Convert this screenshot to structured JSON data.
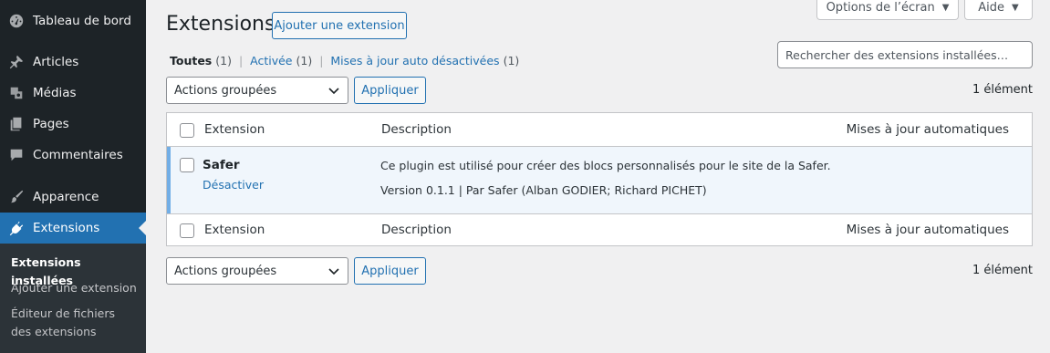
{
  "sidebar": {
    "items": [
      {
        "label": "Tableau de bord",
        "icon": "dashboard-icon"
      },
      {
        "label": "Articles",
        "icon": "pushpin-icon"
      },
      {
        "label": "Médias",
        "icon": "media-icon"
      },
      {
        "label": "Pages",
        "icon": "pages-icon"
      },
      {
        "label": "Commentaires",
        "icon": "comment-icon"
      },
      {
        "label": "Apparence",
        "icon": "paintbrush-icon"
      },
      {
        "label": "Extensions",
        "icon": "plugin-icon",
        "active": true
      }
    ],
    "submenu": [
      {
        "label": "Extensions installées",
        "current": true
      },
      {
        "label": "Ajouter une extension"
      },
      {
        "label": "Éditeur de fichiers des extensions"
      }
    ]
  },
  "screen_options": "Options de l’écran",
  "help": "Aide",
  "page": {
    "title": "Extensions",
    "add_button": "Ajouter une extension"
  },
  "filters": {
    "all_label": "Toutes",
    "all_count": "(1)",
    "active_label": "Activée",
    "active_count": "(1)",
    "auto_label": "Mises à jour auto désactivées",
    "auto_count": "(1)"
  },
  "search": {
    "placeholder": "Rechercher des extensions installées…"
  },
  "bulk": {
    "select_label": "Actions groupées",
    "apply_label": "Appliquer",
    "count": "1 élément"
  },
  "table": {
    "columns": [
      "Extension",
      "Description",
      "Mises à jour automatiques"
    ],
    "rows": [
      {
        "name": "Safer",
        "action": "Désactiver",
        "description": "Ce plugin est utilisé pour créer des blocs personnalisés pour le site de la Safer.",
        "meta": "Version 0.1.1 | Par Safer (Alban GODIER; Richard PICHET)"
      }
    ]
  },
  "colors": {
    "accent": "#2271b1",
    "sidebar_bg": "#1d2327",
    "row_highlight": "#f0f6fc"
  }
}
